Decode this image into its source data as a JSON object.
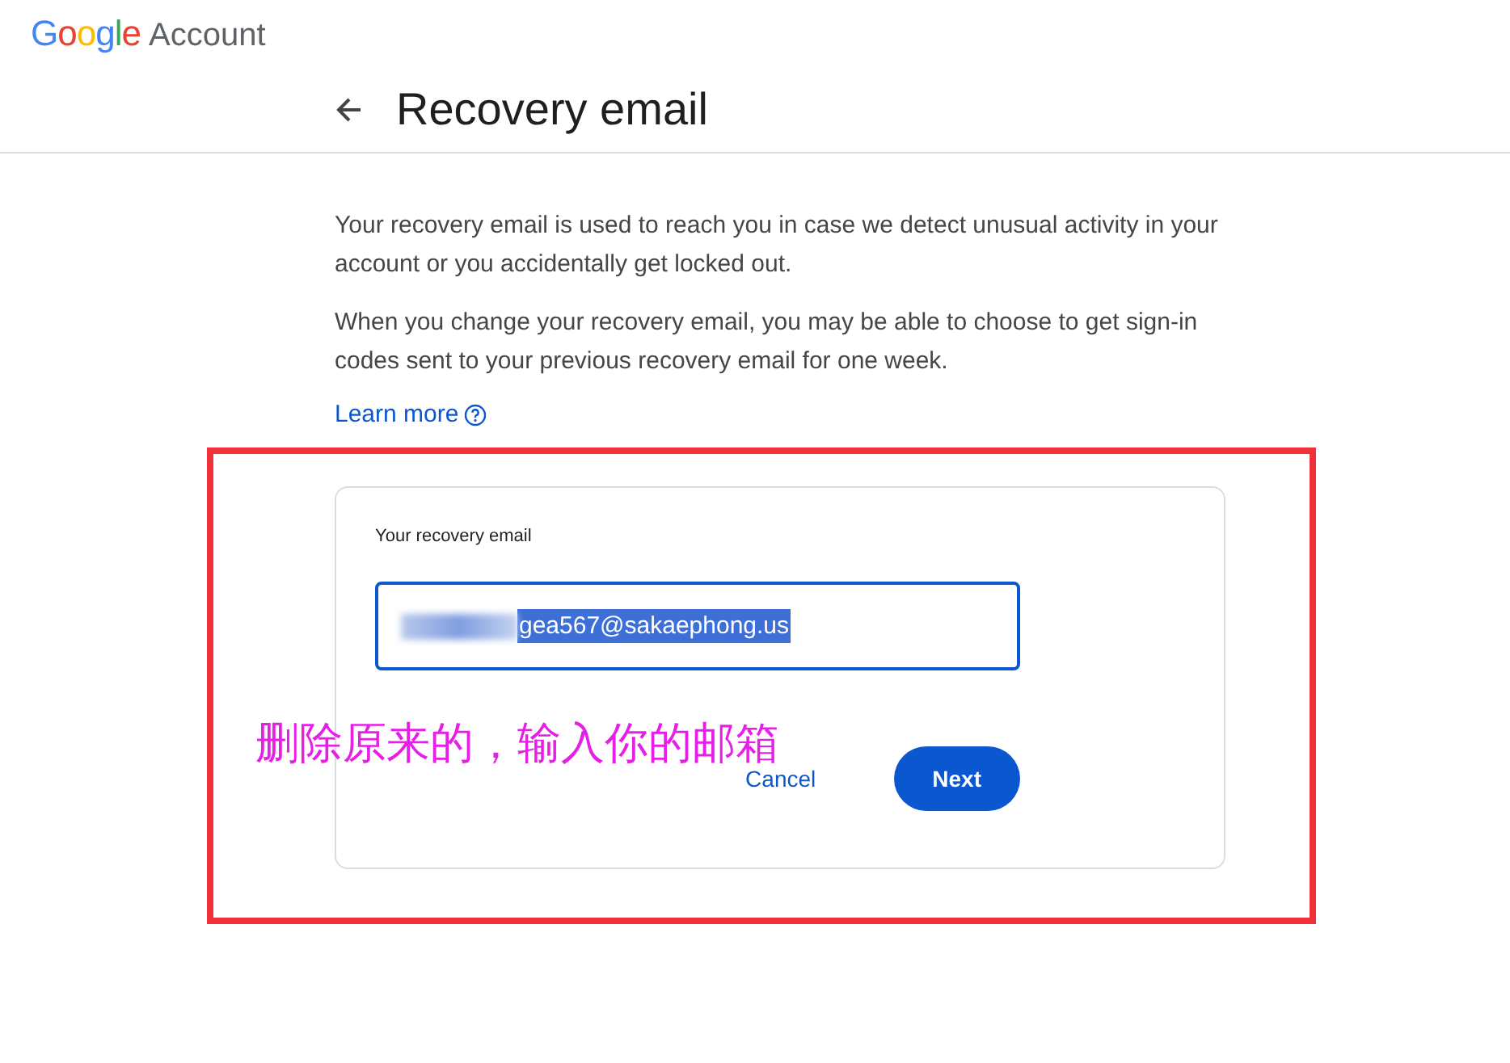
{
  "header": {
    "logo": "Google",
    "product": "Account"
  },
  "page": {
    "title": "Recovery email"
  },
  "paragraphs": [
    "Your recovery email is used to reach you in case we detect unusual activity in your account or you accidentally get locked out.",
    "When you change your recovery email, you may be able to choose to get sign-in codes sent to your previous recovery email for one week."
  ],
  "learn_more": "Learn more",
  "form": {
    "label": "Your recovery email",
    "value": "gea567@sakaephong.us",
    "value_selected": true,
    "value_blurred": true,
    "buttons": [
      {
        "label": "Cancel",
        "kind": "text"
      },
      {
        "label": "Next",
        "kind": "filled"
      }
    ]
  },
  "annotation": {
    "text": "删除原来的，输入你的邮箱"
  }
}
